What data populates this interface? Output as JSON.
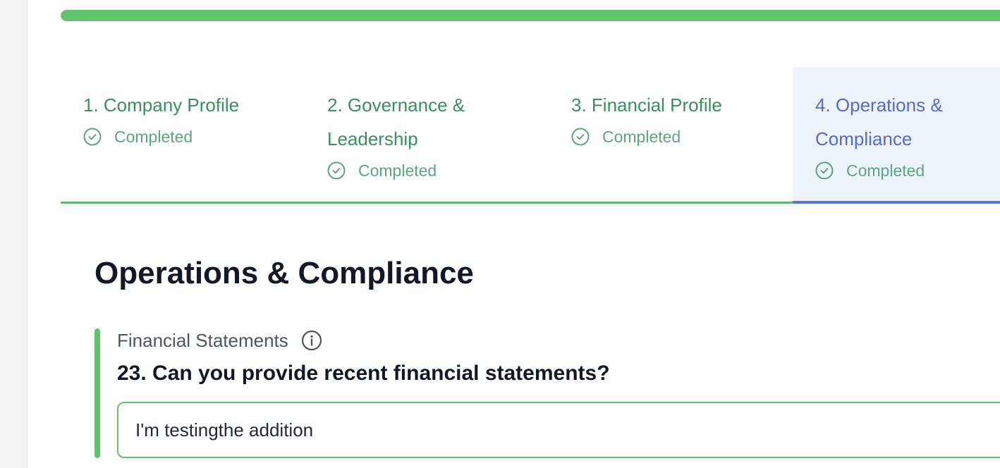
{
  "progress": {
    "value_percent": 100,
    "color": "#5fc46b"
  },
  "steps": [
    {
      "title": "1. Company Profile",
      "status": "Completed",
      "active": false
    },
    {
      "title": "2. Governance & Leadership",
      "status": "Completed",
      "active": false
    },
    {
      "title": "3. Financial Profile",
      "status": "Completed",
      "active": false
    },
    {
      "title": "4. Operations & Compliance",
      "status": "Completed",
      "active": true
    }
  ],
  "section": {
    "title": "Operations & Compliance"
  },
  "question": {
    "category": "Financial Statements",
    "text": "23. Can you provide recent financial statements?",
    "answer": "I'm testingthe addition",
    "info_icon": "info-icon"
  },
  "colors": {
    "completed": "#3a8f5e",
    "active": "#5468d8",
    "accent": "#5fc46b"
  }
}
